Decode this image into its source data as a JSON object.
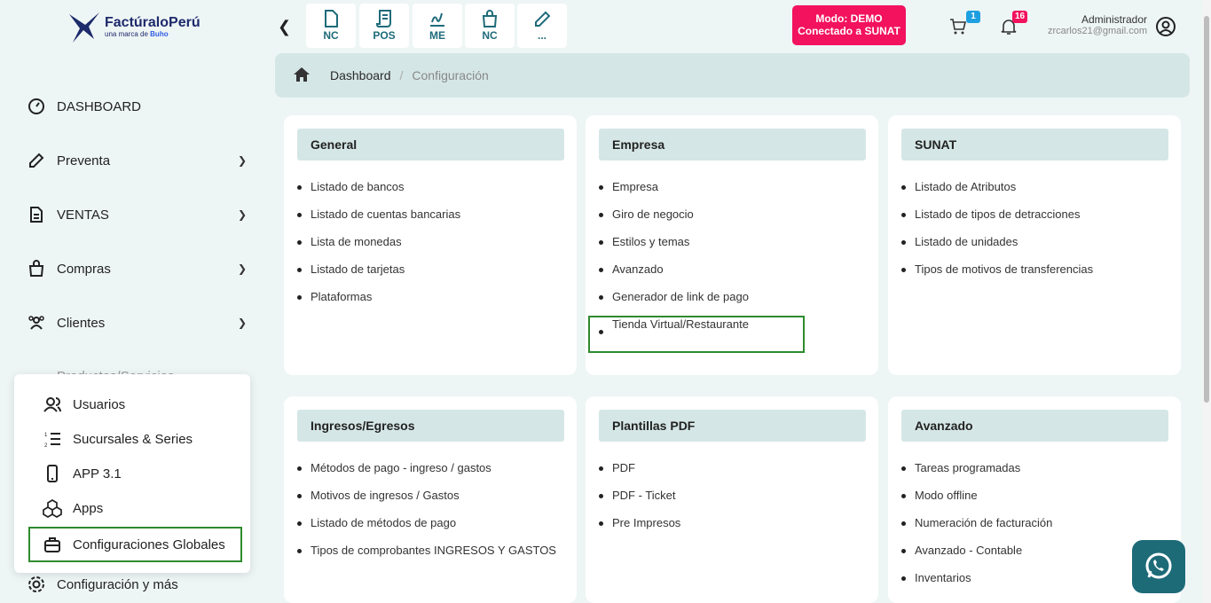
{
  "logo": {
    "brand": "FactúraloPerú",
    "sub_prefix": "una marca de",
    "sub_brand": "Buho"
  },
  "sidebar": {
    "items": [
      {
        "label": "DASHBOARD",
        "icon": "dashboard-icon"
      },
      {
        "label": "Preventa",
        "icon": "edit-icon"
      },
      {
        "label": "VENTAS",
        "icon": "document-icon"
      },
      {
        "label": "Compras",
        "icon": "bag-icon"
      },
      {
        "label": "Clientes",
        "icon": "users-icon"
      },
      {
        "label": "Productos/Servicios",
        "icon": "grid-icon"
      },
      {
        "label": "Configuración y más",
        "icon": "gear-icon"
      }
    ],
    "popup": [
      {
        "label": "Usuarios",
        "icon": "users-icon"
      },
      {
        "label": "Sucursales & Series",
        "icon": "numbered-list-icon"
      },
      {
        "label": "APP 3.1",
        "icon": "phone-icon"
      },
      {
        "label": "Apps",
        "icon": "cubes-icon"
      },
      {
        "label": "Configuraciones Globales",
        "icon": "briefcase-icon"
      }
    ]
  },
  "topbar": {
    "quick": [
      {
        "label": "NC",
        "icon": "file-icon"
      },
      {
        "label": "POS",
        "icon": "receipt-icon"
      },
      {
        "label": "ME",
        "icon": "signature-icon"
      },
      {
        "label": "NC",
        "icon": "bag-icon"
      },
      {
        "label": "...",
        "icon": "pencil-icon"
      }
    ],
    "mode_line1": "Modo: DEMO",
    "mode_line2": "Conectado a SUNAT",
    "cart_count": "1",
    "notif_count": "16",
    "user_name": "Administrador",
    "user_email": "zrcarlos21@gmail.com"
  },
  "breadcrumb": {
    "home": "Dashboard",
    "current": "Configuración"
  },
  "cards": [
    {
      "title": "General",
      "items": [
        "Listado de bancos",
        "Listado de cuentas bancarias",
        "Lista de monedas",
        "Listado de tarjetas",
        "Plataformas"
      ]
    },
    {
      "title": "Empresa",
      "items": [
        "Empresa",
        "Giro de negocio",
        "Estilos y temas",
        "Avanzado",
        "Generador de link de pago",
        "Tienda Virtual/Restaurante"
      ]
    },
    {
      "title": "SUNAT",
      "items": [
        "Listado de Atributos",
        "Listado de tipos de detracciones",
        "Listado de unidades",
        "Tipos de motivos de transferencias"
      ]
    },
    {
      "title": "Ingresos/Egresos",
      "items": [
        "Métodos de pago - ingreso / gastos",
        "Motivos de ingresos / Gastos",
        "Listado de métodos de pago",
        "Tipos de comprobantes INGRESOS Y GASTOS"
      ]
    },
    {
      "title": "Plantillas PDF",
      "items": [
        "PDF",
        "PDF - Ticket",
        "Pre Impresos"
      ]
    },
    {
      "title": "Avanzado",
      "items": [
        "Tareas programadas",
        "Modo offline",
        "Numeración de facturación",
        "Avanzado - Contable",
        "Inventarios"
      ]
    }
  ],
  "colors": {
    "accent": "#1f6b7a",
    "mode_badge": "#f2125d",
    "highlight": "#2e8b2e"
  }
}
